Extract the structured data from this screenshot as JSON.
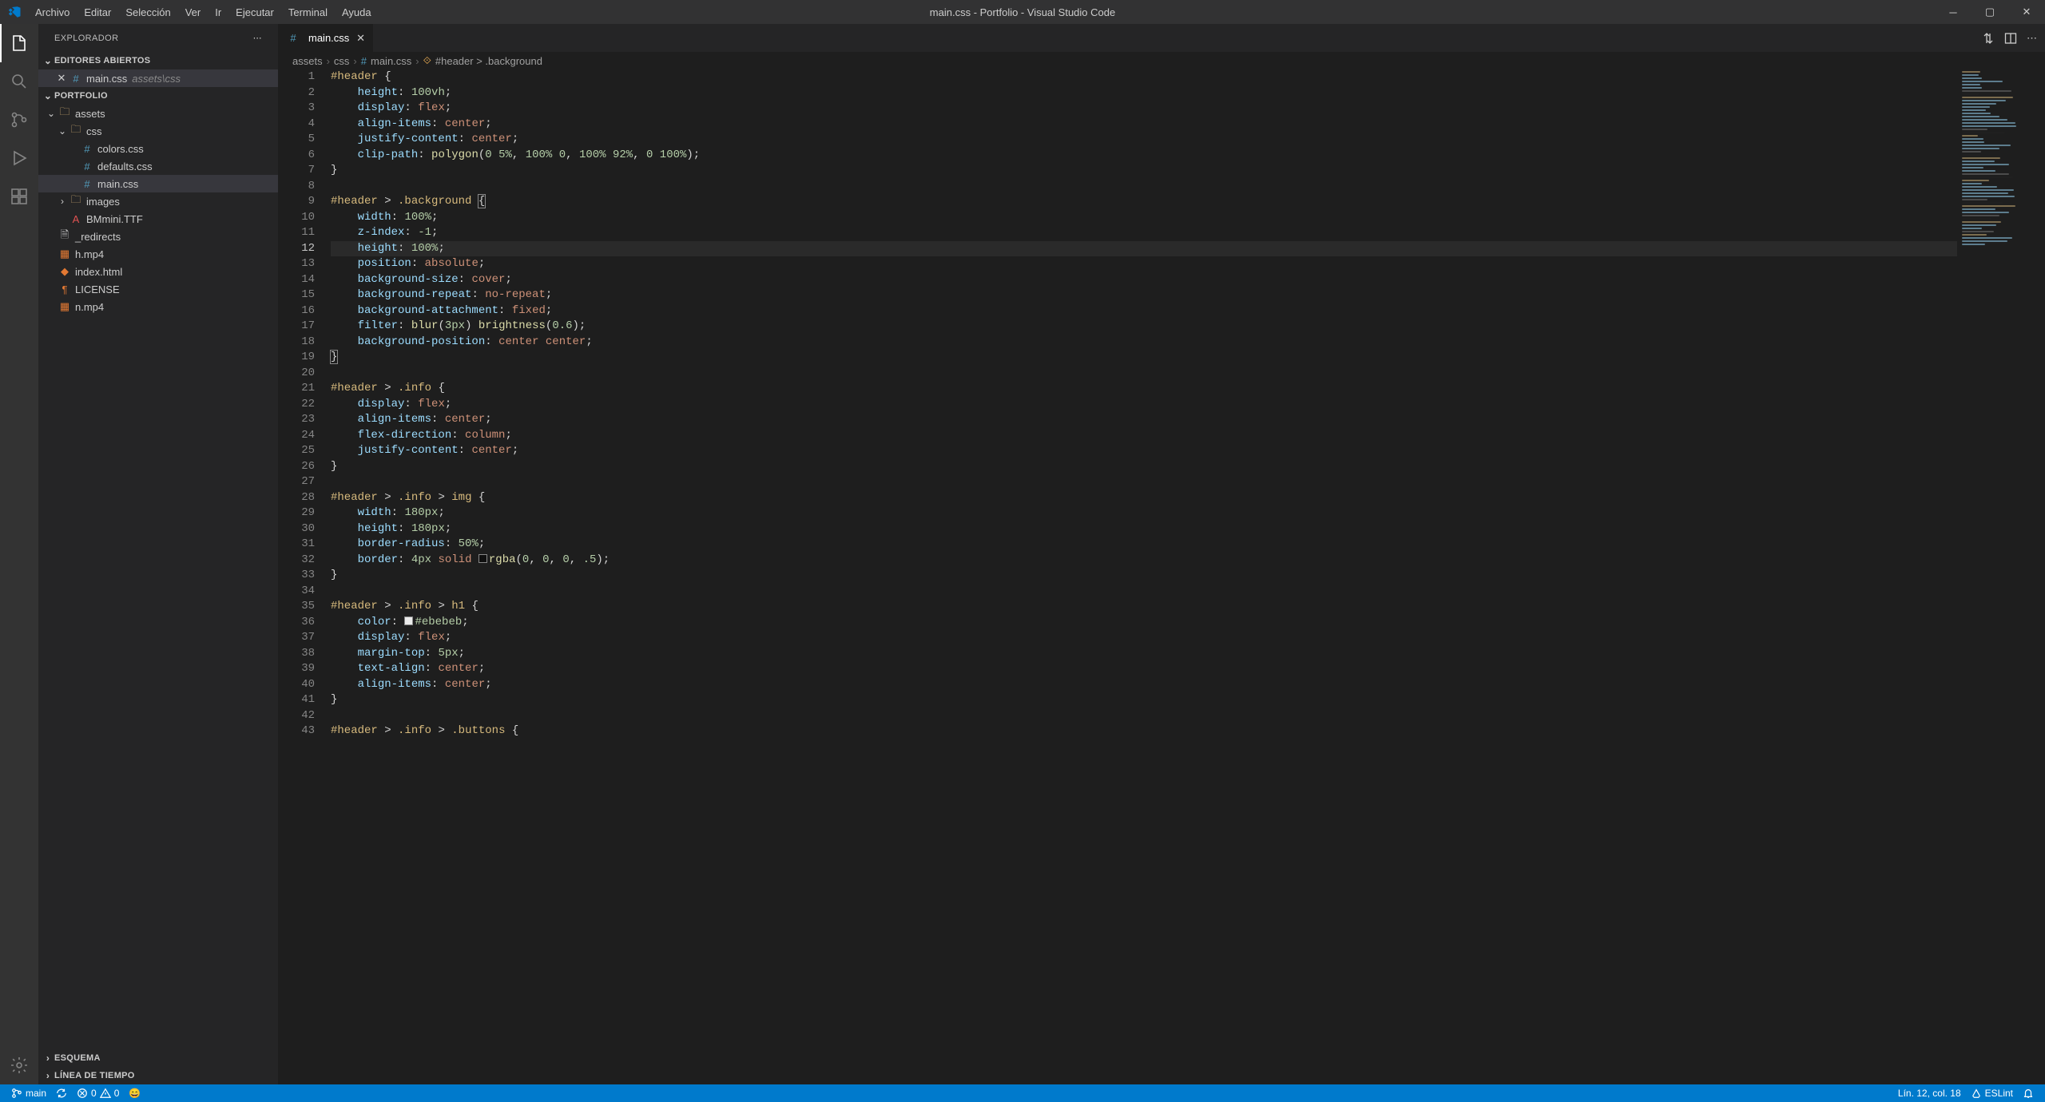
{
  "window": {
    "title": "main.css - Portfolio - Visual Studio Code"
  },
  "menu": [
    "Archivo",
    "Editar",
    "Selección",
    "Ver",
    "Ir",
    "Ejecutar",
    "Terminal",
    "Ayuda"
  ],
  "sidebar": {
    "title": "EXPLORADOR",
    "sections": {
      "openEditors": "EDITORES ABIERTOS",
      "portfolio": "PORTFOLIO",
      "outline": "ESQUEMA",
      "timeline": "LÍNEA DE TIEMPO"
    },
    "openEditorItem": {
      "name": "main.css",
      "path": "assets\\css"
    },
    "tree": {
      "assets": "assets",
      "css": "css",
      "files": {
        "colors": "colors.css",
        "defaults": "defaults.css",
        "main": "main.css",
        "images": "images",
        "bmmini": "BMmini.TTF",
        "redirects": "_redirects",
        "hmp4": "h.mp4",
        "index": "index.html",
        "license": "LICENSE",
        "nmp4": "n.mp4"
      }
    }
  },
  "tab": {
    "name": "main.css"
  },
  "breadcrumbs": {
    "p1": "assets",
    "p2": "css",
    "p3": "main.css",
    "p4": "#header > .background"
  },
  "code": [
    {
      "n": 1,
      "h": "<span class='tok-sel'>#header</span> <span class='tok-punc'>{</span>"
    },
    {
      "n": 2,
      "h": "    <span class='tok-prop'>height</span><span class='tok-punc'>:</span> <span class='tok-num'>100vh</span><span class='tok-punc'>;</span>"
    },
    {
      "n": 3,
      "h": "    <span class='tok-prop'>display</span><span class='tok-punc'>:</span> <span class='tok-val'>flex</span><span class='tok-punc'>;</span>"
    },
    {
      "n": 4,
      "h": "    <span class='tok-prop'>align-items</span><span class='tok-punc'>:</span> <span class='tok-val'>center</span><span class='tok-punc'>;</span>"
    },
    {
      "n": 5,
      "h": "    <span class='tok-prop'>justify-content</span><span class='tok-punc'>:</span> <span class='tok-val'>center</span><span class='tok-punc'>;</span>"
    },
    {
      "n": 6,
      "h": "    <span class='tok-prop'>clip-path</span><span class='tok-punc'>:</span> <span class='tok-func'>polygon</span><span class='tok-punc'>(</span><span class='tok-num'>0</span> <span class='tok-num'>5%</span><span class='tok-punc'>,</span> <span class='tok-num'>100%</span> <span class='tok-num'>0</span><span class='tok-punc'>,</span> <span class='tok-num'>100%</span> <span class='tok-num'>92%</span><span class='tok-punc'>,</span> <span class='tok-num'>0</span> <span class='tok-num'>100%</span><span class='tok-punc'>);</span>"
    },
    {
      "n": 7,
      "h": "<span class='tok-punc'>}</span>"
    },
    {
      "n": 8,
      "h": ""
    },
    {
      "n": 9,
      "h": "<span class='tok-sel'>#header</span> <span class='tok-op'>&gt;</span> <span class='tok-sel'>.background</span> <span class='tok-punc brace-match'>{</span>"
    },
    {
      "n": 10,
      "h": "    <span class='tok-prop'>width</span><span class='tok-punc'>:</span> <span class='tok-num'>100%</span><span class='tok-punc'>;</span>"
    },
    {
      "n": 11,
      "h": "    <span class='tok-prop'>z-index</span><span class='tok-punc'>:</span> <span class='tok-num'>-1</span><span class='tok-punc'>;</span>"
    },
    {
      "n": 12,
      "hl": true,
      "h": "    <span class='tok-prop'>height</span><span class='tok-punc'>:</span> <span class='tok-num'>100%</span><span class='tok-punc'>;</span>"
    },
    {
      "n": 13,
      "h": "    <span class='tok-prop'>position</span><span class='tok-punc'>:</span> <span class='tok-val'>absolute</span><span class='tok-punc'>;</span>"
    },
    {
      "n": 14,
      "h": "    <span class='tok-prop'>background-size</span><span class='tok-punc'>:</span> <span class='tok-val'>cover</span><span class='tok-punc'>;</span>"
    },
    {
      "n": 15,
      "h": "    <span class='tok-prop'>background-repeat</span><span class='tok-punc'>:</span> <span class='tok-val'>no-repeat</span><span class='tok-punc'>;</span>"
    },
    {
      "n": 16,
      "h": "    <span class='tok-prop'>background-attachment</span><span class='tok-punc'>:</span> <span class='tok-val'>fixed</span><span class='tok-punc'>;</span>"
    },
    {
      "n": 17,
      "h": "    <span class='tok-prop'>filter</span><span class='tok-punc'>:</span> <span class='tok-func'>blur</span><span class='tok-punc'>(</span><span class='tok-num'>3px</span><span class='tok-punc'>)</span> <span class='tok-func'>brightness</span><span class='tok-punc'>(</span><span class='tok-num'>0.6</span><span class='tok-punc'>);</span>"
    },
    {
      "n": 18,
      "h": "    <span class='tok-prop'>background-position</span><span class='tok-punc'>:</span> <span class='tok-val'>center</span> <span class='tok-val'>center</span><span class='tok-punc'>;</span>"
    },
    {
      "n": 19,
      "h": "<span class='tok-punc brace-match'>}</span>"
    },
    {
      "n": 20,
      "h": ""
    },
    {
      "n": 21,
      "h": "<span class='tok-sel'>#header</span> <span class='tok-op'>&gt;</span> <span class='tok-sel'>.info</span> <span class='tok-punc'>{</span>"
    },
    {
      "n": 22,
      "h": "    <span class='tok-prop'>display</span><span class='tok-punc'>:</span> <span class='tok-val'>flex</span><span class='tok-punc'>;</span>"
    },
    {
      "n": 23,
      "h": "    <span class='tok-prop'>align-items</span><span class='tok-punc'>:</span> <span class='tok-val'>center</span><span class='tok-punc'>;</span>"
    },
    {
      "n": 24,
      "h": "    <span class='tok-prop'>flex-direction</span><span class='tok-punc'>:</span> <span class='tok-val'>column</span><span class='tok-punc'>;</span>"
    },
    {
      "n": 25,
      "h": "    <span class='tok-prop'>justify-content</span><span class='tok-punc'>:</span> <span class='tok-val'>center</span><span class='tok-punc'>;</span>"
    },
    {
      "n": 26,
      "h": "<span class='tok-punc'>}</span>"
    },
    {
      "n": 27,
      "h": ""
    },
    {
      "n": 28,
      "h": "<span class='tok-sel'>#header</span> <span class='tok-op'>&gt;</span> <span class='tok-sel'>.info</span> <span class='tok-op'>&gt;</span> <span class='tok-sel'>img</span> <span class='tok-punc'>{</span>"
    },
    {
      "n": 29,
      "h": "    <span class='tok-prop'>width</span><span class='tok-punc'>:</span> <span class='tok-num'>180px</span><span class='tok-punc'>;</span>"
    },
    {
      "n": 30,
      "h": "    <span class='tok-prop'>height</span><span class='tok-punc'>:</span> <span class='tok-num'>180px</span><span class='tok-punc'>;</span>"
    },
    {
      "n": 31,
      "h": "    <span class='tok-prop'>border-radius</span><span class='tok-punc'>:</span> <span class='tok-num'>50%</span><span class='tok-punc'>;</span>"
    },
    {
      "n": 32,
      "h": "    <span class='tok-prop'>border</span><span class='tok-punc'>:</span> <span class='tok-num'>4px</span> <span class='tok-val'>solid</span> <span class='colorbox' style='background:rgba(0,0,0,.5)'></span><span class='tok-func'>rgba</span><span class='tok-punc'>(</span><span class='tok-num'>0</span><span class='tok-punc'>,</span> <span class='tok-num'>0</span><span class='tok-punc'>,</span> <span class='tok-num'>0</span><span class='tok-punc'>,</span> <span class='tok-num'>.5</span><span class='tok-punc'>);</span>"
    },
    {
      "n": 33,
      "h": "<span class='tok-punc'>}</span>"
    },
    {
      "n": 34,
      "h": ""
    },
    {
      "n": 35,
      "h": "<span class='tok-sel'>#header</span> <span class='tok-op'>&gt;</span> <span class='tok-sel'>.info</span> <span class='tok-op'>&gt;</span> <span class='tok-sel'>h1</span> <span class='tok-punc'>{</span>"
    },
    {
      "n": 36,
      "h": "    <span class='tok-prop'>color</span><span class='tok-punc'>:</span> <span class='colorbox' style='background:#ebebeb'></span><span class='tok-num'>#ebebeb</span><span class='tok-punc'>;</span>"
    },
    {
      "n": 37,
      "h": "    <span class='tok-prop'>display</span><span class='tok-punc'>:</span> <span class='tok-val'>flex</span><span class='tok-punc'>;</span>"
    },
    {
      "n": 38,
      "h": "    <span class='tok-prop'>margin-top</span><span class='tok-punc'>:</span> <span class='tok-num'>5px</span><span class='tok-punc'>;</span>"
    },
    {
      "n": 39,
      "h": "    <span class='tok-prop'>text-align</span><span class='tok-punc'>:</span> <span class='tok-val'>center</span><span class='tok-punc'>;</span>"
    },
    {
      "n": 40,
      "h": "    <span class='tok-prop'>align-items</span><span class='tok-punc'>:</span> <span class='tok-val'>center</span><span class='tok-punc'>;</span>"
    },
    {
      "n": 41,
      "h": "<span class='tok-punc'>}</span>"
    },
    {
      "n": 42,
      "h": ""
    },
    {
      "n": 43,
      "h": "<span class='tok-sel'>#header</span> <span class='tok-op'>&gt;</span> <span class='tok-sel'>.info</span> <span class='tok-op'>&gt;</span> <span class='tok-sel'>.buttons</span> <span class='tok-punc'>{</span>"
    }
  ],
  "status": {
    "branch": "main",
    "errors": "0",
    "warnings": "0",
    "lineCol": "Lín. 12, col. 18",
    "eslint": "ESLint"
  }
}
